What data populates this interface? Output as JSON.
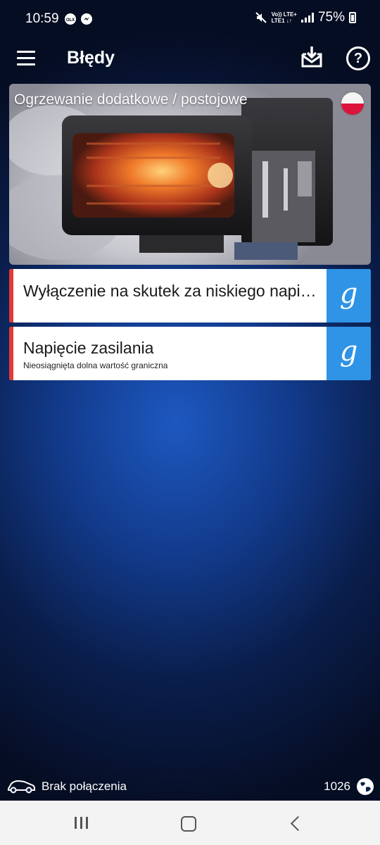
{
  "status_bar": {
    "time": "10:59",
    "app_icon_1": "OLX",
    "network_line1": "Vo)) LTE+",
    "network_line2": "LTE1 ↓↑",
    "battery": "75%"
  },
  "header": {
    "title": "Błędy",
    "icons": [
      "menu-icon",
      "download-inbox-icon",
      "help-icon"
    ]
  },
  "device": {
    "title": "Ogrzewanie dodatkowe / postojowe",
    "flag": "poland-flag-icon"
  },
  "errors": [
    {
      "title": "Wyłączenie na skutek za niskiego napięc..",
      "subtitle": "",
      "action_icon": "google-icon"
    },
    {
      "title": "Napięcie zasilania",
      "subtitle": "Nieosiągnięta dolna wartość graniczna",
      "action_icon": "google-icon"
    }
  ],
  "connection": {
    "status": "Brak połączenia",
    "count": "1026"
  },
  "colors": {
    "accent_red": "#e53935",
    "google_button_blue": "#2f93e6",
    "background_blue": "#1d58c0"
  }
}
